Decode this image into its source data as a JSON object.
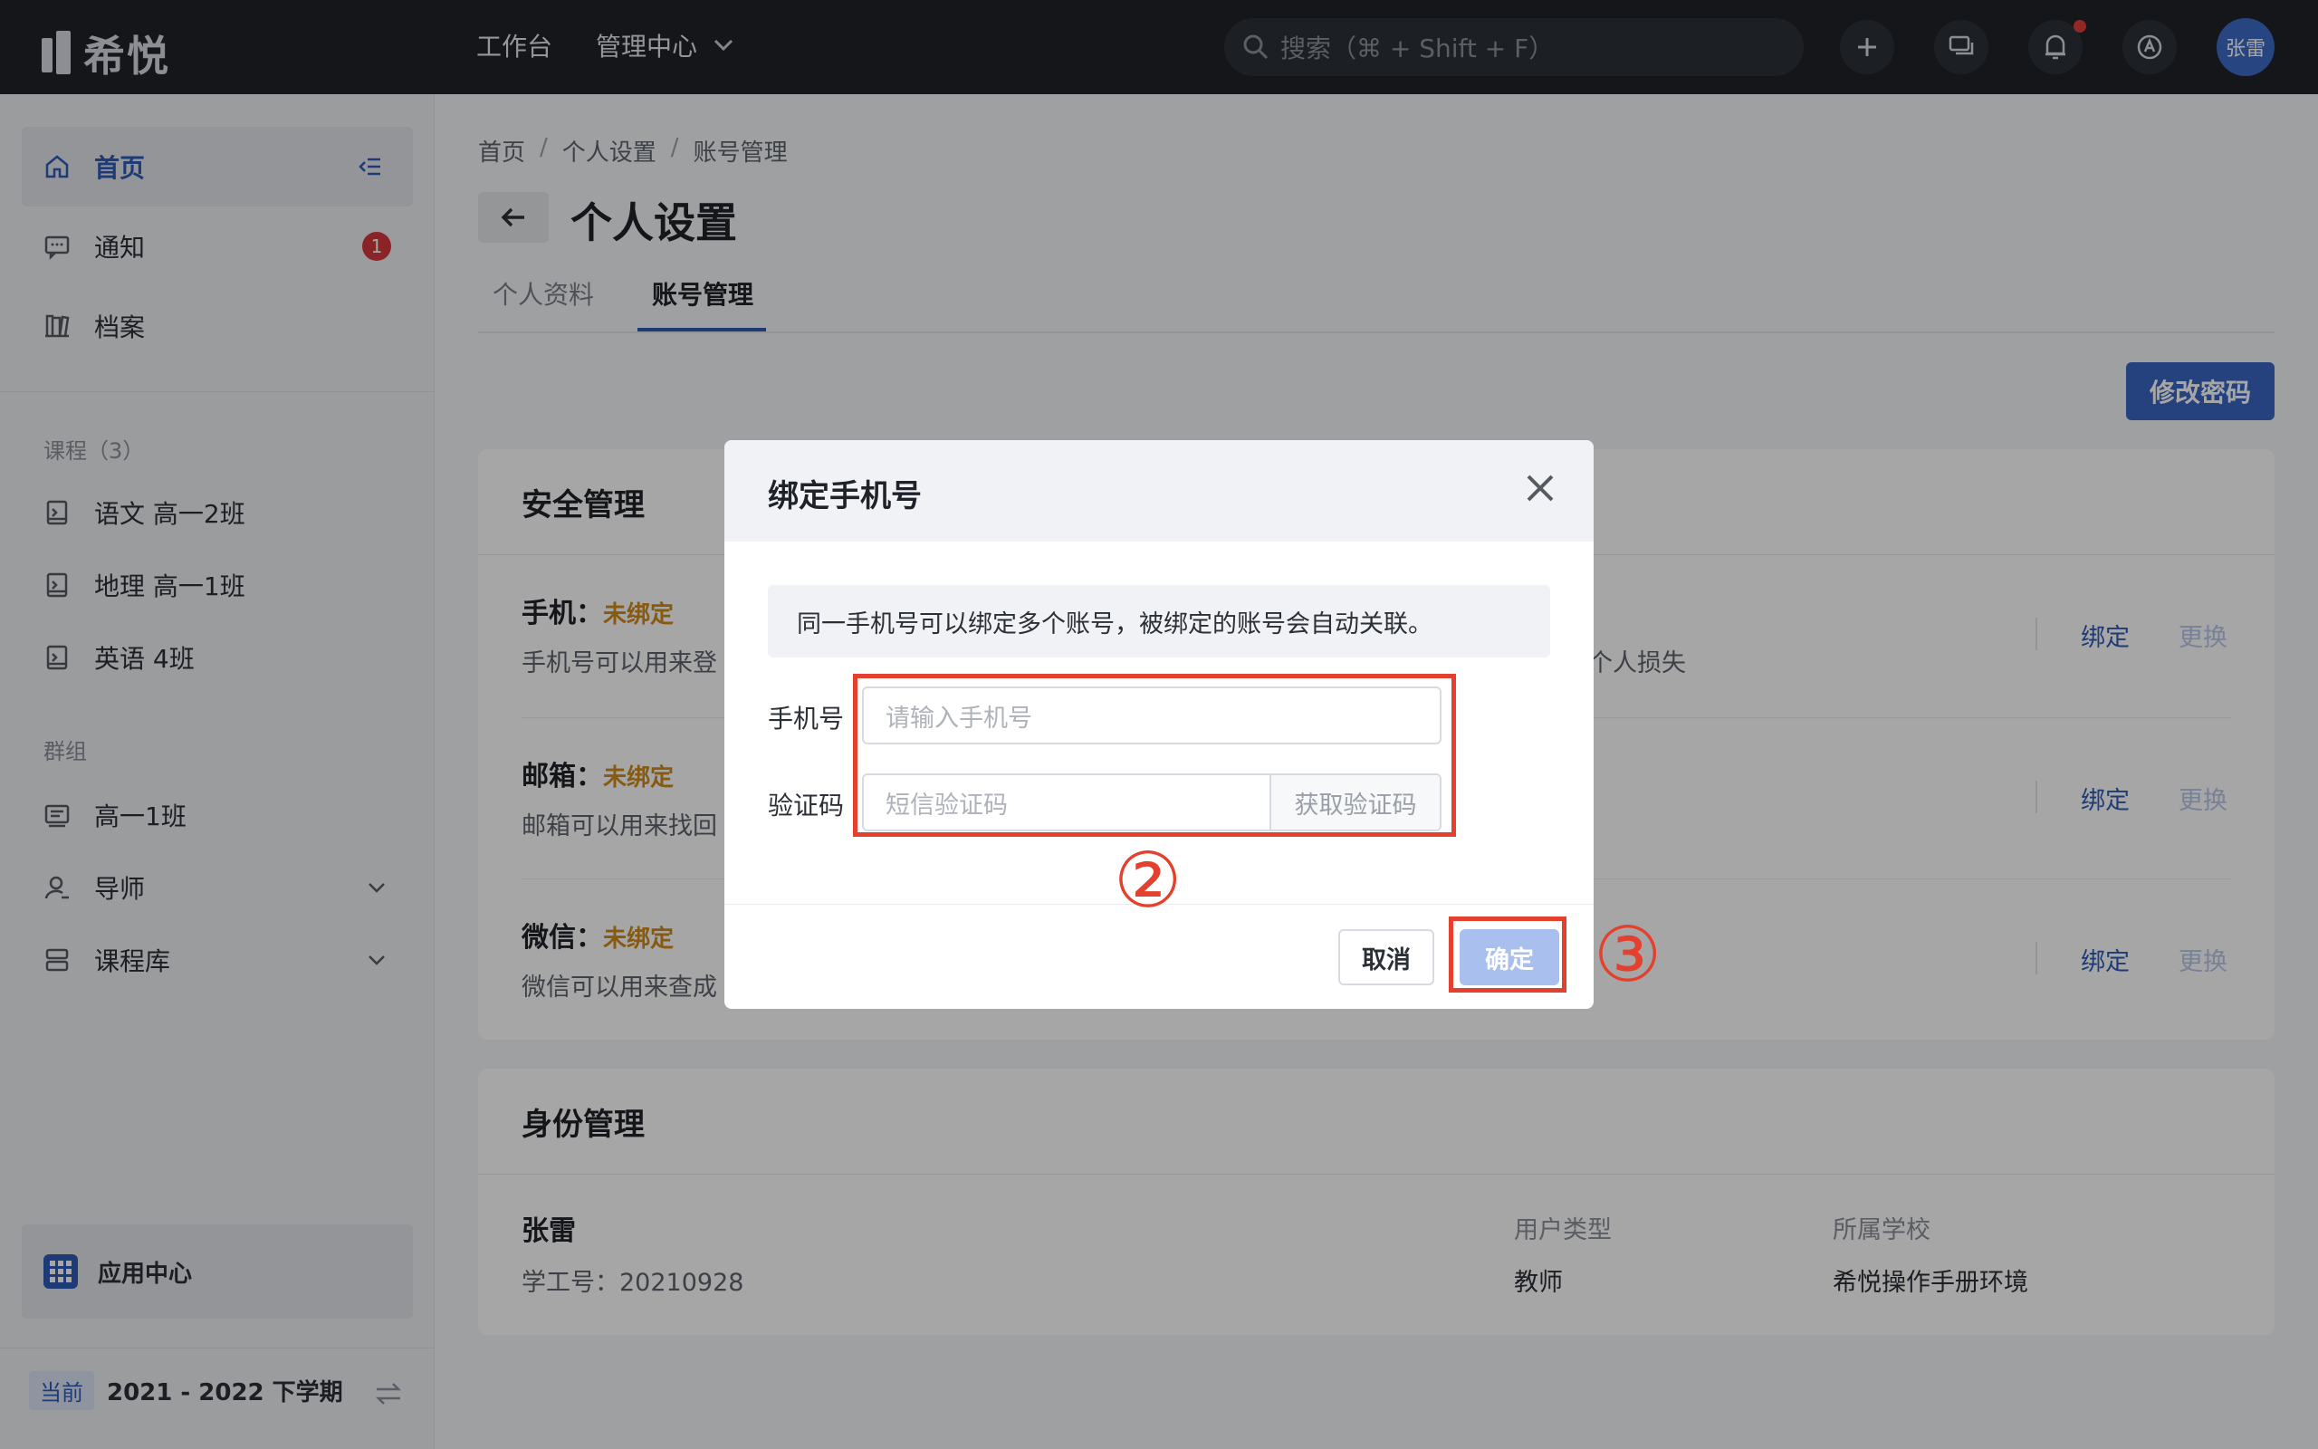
{
  "app": {
    "name": "希悦"
  },
  "topnav": {
    "workbench": "工作台",
    "management": "管理中心"
  },
  "search": {
    "placeholder": "搜索（⌘ + Shift + F）"
  },
  "user": {
    "avatar_text": "张雷"
  },
  "sidebar": {
    "items": [
      {
        "label": "首页"
      },
      {
        "label": "通知",
        "badge": "1"
      },
      {
        "label": "档案"
      }
    ],
    "courses_title": "课程（3）",
    "courses": [
      {
        "label": "语文 高一2班"
      },
      {
        "label": "地理 高一1班"
      },
      {
        "label": "英语 4班"
      }
    ],
    "groups_title": "群组",
    "groups": [
      {
        "label": "高一1班"
      },
      {
        "label": "导师"
      },
      {
        "label": "课程库"
      }
    ],
    "app_center": "应用中心",
    "term_tag": "当前",
    "term_value": "2021 - 2022 下学期"
  },
  "breadcrumb": [
    "首页",
    "/",
    "个人设置",
    "/",
    "账号管理"
  ],
  "page": {
    "title": "个人设置",
    "tabs": [
      "个人资料",
      "账号管理"
    ],
    "change_password": "修改密码"
  },
  "security": {
    "title": "安全管理",
    "rows": [
      {
        "label": "手机：",
        "status": "未绑定",
        "desc": "手机号可以用来登",
        "desc_tail": "个人损失",
        "bind": "绑定",
        "change": "更换"
      },
      {
        "label": "邮箱：",
        "status": "未绑定",
        "desc": "邮箱可以用来找回",
        "bind": "绑定",
        "change": "更换"
      },
      {
        "label": "微信：",
        "status": "未绑定",
        "desc": "微信可以用来查成",
        "bind": "绑定",
        "change": "更换"
      }
    ]
  },
  "identity": {
    "title": "身份管理",
    "name": "张雷",
    "id_line": "学工号：20210928",
    "type_label": "用户类型",
    "type_value": "教师",
    "school_label": "所属学校",
    "school_value": "希悦操作手册环境"
  },
  "modal": {
    "title": "绑定手机号",
    "notice": "同一手机号可以绑定多个账号，被绑定的账号会自动关联。",
    "phone_label": "手机号",
    "phone_placeholder": "请输入手机号",
    "code_label": "验证码",
    "code_placeholder": "短信验证码",
    "get_code": "获取验证码",
    "cancel": "取消",
    "confirm": "确定"
  },
  "annotations": {
    "step2": "②",
    "step3": "③",
    "color": "#e3402d"
  },
  "colors": {
    "topbar": "#1f2329",
    "accent": "#2f5bb7",
    "warning": "#d08a1a",
    "badge": "#d4383b"
  }
}
